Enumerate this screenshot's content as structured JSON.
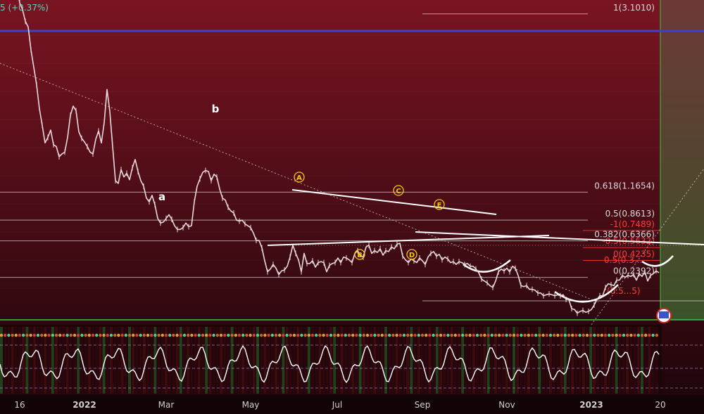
{
  "header": {
    "price_change": "5 (+0.37%)"
  },
  "chart_data": {
    "type": "line",
    "x_axis": {
      "ticks": [
        "16",
        "2022",
        "Mar",
        "May",
        "Jul",
        "Sep",
        "Nov",
        "2023",
        "20"
      ]
    },
    "series": [
      {
        "values": [
          [
            0,
            3.55
          ],
          [
            4,
            3.49
          ],
          [
            8,
            3.52
          ],
          [
            12,
            3.47
          ],
          [
            16,
            3.58
          ],
          [
            18,
            3.66
          ],
          [
            20,
            3.6
          ],
          [
            24,
            3.38
          ],
          [
            28,
            3.22
          ],
          [
            32,
            3.15
          ],
          [
            36,
            3.02
          ],
          [
            40,
            2.96
          ],
          [
            44,
            2.71
          ],
          [
            48,
            2.52
          ],
          [
            52,
            2.33
          ],
          [
            56,
            2.07
          ],
          [
            60,
            1.89
          ],
          [
            64,
            1.7
          ],
          [
            68,
            1.76
          ],
          [
            72,
            1.84
          ],
          [
            76,
            1.68
          ],
          [
            80,
            1.66
          ],
          [
            84,
            1.55
          ],
          [
            88,
            1.58
          ],
          [
            92,
            1.6
          ],
          [
            96,
            1.76
          ],
          [
            100,
            2.0
          ],
          [
            104,
            2.1
          ],
          [
            108,
            2.05
          ],
          [
            112,
            1.82
          ],
          [
            116,
            1.75
          ],
          [
            120,
            1.71
          ],
          [
            124,
            1.66
          ],
          [
            128,
            1.6
          ],
          [
            132,
            1.58
          ],
          [
            136,
            1.74
          ],
          [
            140,
            1.83
          ],
          [
            144,
            1.7
          ],
          [
            148,
            1.92
          ],
          [
            152,
            2.28
          ],
          [
            156,
            2.04
          ],
          [
            160,
            1.66
          ],
          [
            164,
            1.29
          ],
          [
            168,
            1.26
          ],
          [
            172,
            1.41
          ],
          [
            176,
            1.33
          ],
          [
            180,
            1.37
          ],
          [
            184,
            1.3
          ],
          [
            188,
            1.43
          ],
          [
            192,
            1.52
          ],
          [
            196,
            1.39
          ],
          [
            200,
            1.29
          ],
          [
            204,
            1.23
          ],
          [
            208,
            1.1
          ],
          [
            212,
            1.06
          ],
          [
            216,
            1.13
          ],
          [
            220,
            1.03
          ],
          [
            224,
            0.88
          ],
          [
            228,
            0.83
          ],
          [
            232,
            0.84
          ],
          [
            236,
            0.88
          ],
          [
            240,
            0.92
          ],
          [
            244,
            0.87
          ],
          [
            248,
            0.8
          ],
          [
            252,
            0.76
          ],
          [
            256,
            0.76
          ],
          [
            260,
            0.78
          ],
          [
            264,
            0.83
          ],
          [
            268,
            0.79
          ],
          [
            272,
            0.8
          ],
          [
            276,
            1.06
          ],
          [
            280,
            1.23
          ],
          [
            284,
            1.31
          ],
          [
            288,
            1.38
          ],
          [
            292,
            1.4
          ],
          [
            296,
            1.39
          ],
          [
            300,
            1.29
          ],
          [
            304,
            1.36
          ],
          [
            308,
            1.33
          ],
          [
            312,
            1.2
          ],
          [
            316,
            1.1
          ],
          [
            320,
            1.08
          ],
          [
            324,
            1.0
          ],
          [
            328,
            0.96
          ],
          [
            332,
            0.94
          ],
          [
            336,
            0.86
          ],
          [
            340,
            0.85
          ],
          [
            344,
            0.86
          ],
          [
            348,
            0.82
          ],
          [
            352,
            0.8
          ],
          [
            356,
            0.78
          ],
          [
            360,
            0.72
          ],
          [
            364,
            0.64
          ],
          [
            368,
            0.64
          ],
          [
            372,
            0.56
          ],
          [
            376,
            0.42
          ],
          [
            380,
            0.3
          ],
          [
            384,
            0.33
          ],
          [
            388,
            0.38
          ],
          [
            392,
            0.34
          ],
          [
            396,
            0.27
          ],
          [
            400,
            0.31
          ],
          [
            404,
            0.32
          ],
          [
            408,
            0.36
          ],
          [
            412,
            0.46
          ],
          [
            416,
            0.59
          ],
          [
            420,
            0.5
          ],
          [
            424,
            0.43
          ],
          [
            428,
            0.3
          ],
          [
            432,
            0.5
          ],
          [
            436,
            0.39
          ],
          [
            440,
            0.39
          ],
          [
            444,
            0.42
          ],
          [
            448,
            0.35
          ],
          [
            452,
            0.4
          ],
          [
            456,
            0.41
          ],
          [
            460,
            0.4
          ],
          [
            464,
            0.3
          ],
          [
            468,
            0.37
          ],
          [
            472,
            0.39
          ],
          [
            476,
            0.4
          ],
          [
            480,
            0.45
          ],
          [
            484,
            0.4
          ],
          [
            488,
            0.46
          ],
          [
            492,
            0.45
          ],
          [
            496,
            0.43
          ],
          [
            500,
            0.4
          ],
          [
            504,
            0.5
          ],
          [
            508,
            0.53
          ],
          [
            512,
            0.47
          ],
          [
            516,
            0.46
          ],
          [
            520,
            0.57
          ],
          [
            524,
            0.59
          ],
          [
            528,
            0.5
          ],
          [
            532,
            0.53
          ],
          [
            536,
            0.51
          ],
          [
            540,
            0.55
          ],
          [
            544,
            0.48
          ],
          [
            548,
            0.53
          ],
          [
            552,
            0.52
          ],
          [
            556,
            0.57
          ],
          [
            560,
            0.55
          ],
          [
            564,
            0.6
          ],
          [
            568,
            0.61
          ],
          [
            572,
            0.47
          ],
          [
            576,
            0.43
          ],
          [
            580,
            0.4
          ],
          [
            584,
            0.44
          ],
          [
            588,
            0.42
          ],
          [
            592,
            0.4
          ],
          [
            596,
            0.45
          ],
          [
            600,
            0.42
          ],
          [
            604,
            0.38
          ],
          [
            608,
            0.46
          ],
          [
            612,
            0.5
          ],
          [
            616,
            0.52
          ],
          [
            620,
            0.47
          ],
          [
            624,
            0.49
          ],
          [
            628,
            0.43
          ],
          [
            632,
            0.46
          ],
          [
            636,
            0.44
          ],
          [
            640,
            0.4
          ],
          [
            644,
            0.41
          ],
          [
            648,
            0.38
          ],
          [
            652,
            0.41
          ],
          [
            656,
            0.4
          ],
          [
            660,
            0.38
          ],
          [
            664,
            0.39
          ],
          [
            668,
            0.36
          ],
          [
            672,
            0.36
          ],
          [
            676,
            0.33
          ],
          [
            680,
            0.29
          ],
          [
            684,
            0.22
          ],
          [
            688,
            0.2
          ],
          [
            692,
            0.18
          ],
          [
            696,
            0.15
          ],
          [
            700,
            0.13
          ],
          [
            704,
            0.2
          ],
          [
            708,
            0.3
          ],
          [
            712,
            0.33
          ],
          [
            716,
            0.31
          ],
          [
            720,
            0.34
          ],
          [
            724,
            0.3
          ],
          [
            728,
            0.36
          ],
          [
            732,
            0.34
          ],
          [
            736,
            0.26
          ],
          [
            740,
            0.15
          ],
          [
            744,
            0.14
          ],
          [
            748,
            0.15
          ],
          [
            752,
            0.11
          ],
          [
            756,
            0.11
          ],
          [
            760,
            0.1
          ],
          [
            764,
            0.07
          ],
          [
            768,
            0.07
          ],
          [
            772,
            0.04
          ],
          [
            776,
            0.05
          ],
          [
            780,
            0.06
          ],
          [
            784,
            0.05
          ],
          [
            788,
            0.04
          ],
          [
            792,
            0.05
          ],
          [
            796,
            0.04
          ],
          [
            800,
            0.05
          ],
          [
            804,
            0.0
          ],
          [
            808,
            0.0
          ],
          [
            812,
            -0.1
          ],
          [
            816,
            -0.11
          ],
          [
            820,
            -0.15
          ],
          [
            824,
            -0.13
          ],
          [
            828,
            -0.12
          ],
          [
            832,
            -0.14
          ],
          [
            836,
            -0.13
          ],
          [
            840,
            -0.11
          ],
          [
            844,
            -0.06
          ],
          [
            848,
            0.0
          ],
          [
            852,
            0.04
          ],
          [
            856,
            0.04
          ],
          [
            860,
            0.13
          ],
          [
            864,
            0.17
          ],
          [
            868,
            0.16
          ],
          [
            872,
            0.15
          ],
          [
            876,
            0.21
          ],
          [
            880,
            0.21
          ],
          [
            884,
            0.26
          ],
          [
            888,
            0.24
          ],
          [
            892,
            0.26
          ],
          [
            896,
            0.25
          ],
          [
            900,
            0.27
          ],
          [
            904,
            0.21
          ],
          [
            908,
            0.28
          ],
          [
            912,
            0.25
          ],
          [
            916,
            0.3
          ],
          [
            920,
            0.2
          ],
          [
            924,
            0.26
          ],
          [
            928,
            0.28
          ],
          [
            932,
            0.31
          ],
          [
            936,
            0.29
          ]
        ]
      }
    ],
    "fib_levels": [
      {
        "label": "1(3.1010)",
        "value": 3.101,
        "color": "#d8d8d8"
      },
      {
        "label": "0.618(1.1654)",
        "value": 1.1654,
        "color": "#d8d8d8"
      },
      {
        "label": "0.5(0.8613)",
        "value": 0.8613,
        "color": "#d8d8d8"
      },
      {
        "label": "-1(0.7489)",
        "value": 0.7489,
        "color": "#ff3b3b"
      },
      {
        "label": "0.382(0.6366)",
        "value": 0.6366,
        "color": "#d8d8d8"
      },
      {
        "label": "-0.5(0.5632)",
        "value": 0.5632,
        "color": "#ff3b3b"
      },
      {
        "label": "0(0.4235)",
        "value": 0.4235,
        "color": "#ff3b3b"
      },
      {
        "label": "0(0.2392)",
        "value": 0.2392,
        "color": "#d8d8d8"
      }
    ],
    "fib_overlaps": [
      "0.5(0.3...",
      "(0.5...5)"
    ],
    "wave_labels": [
      {
        "text": "b",
        "style": "plain"
      },
      {
        "text": "a",
        "style": "plain"
      },
      {
        "text": "A",
        "style": "circle"
      },
      {
        "text": "B",
        "style": "circle"
      },
      {
        "text": "C",
        "style": "circle"
      },
      {
        "text": "D",
        "style": "circle"
      },
      {
        "text": "E",
        "style": "circle"
      }
    ],
    "colors": {
      "background_top": "#7a1422",
      "background_bottom": "#1a0509",
      "future_zone": "#6b6a3c",
      "price_line": "#e9d9db",
      "horizontal_band": "#4040c0",
      "ma_line": "#2ecc40",
      "wave_label_circle": "#f5c518",
      "oscillator_line": "#ffffff"
    }
  }
}
